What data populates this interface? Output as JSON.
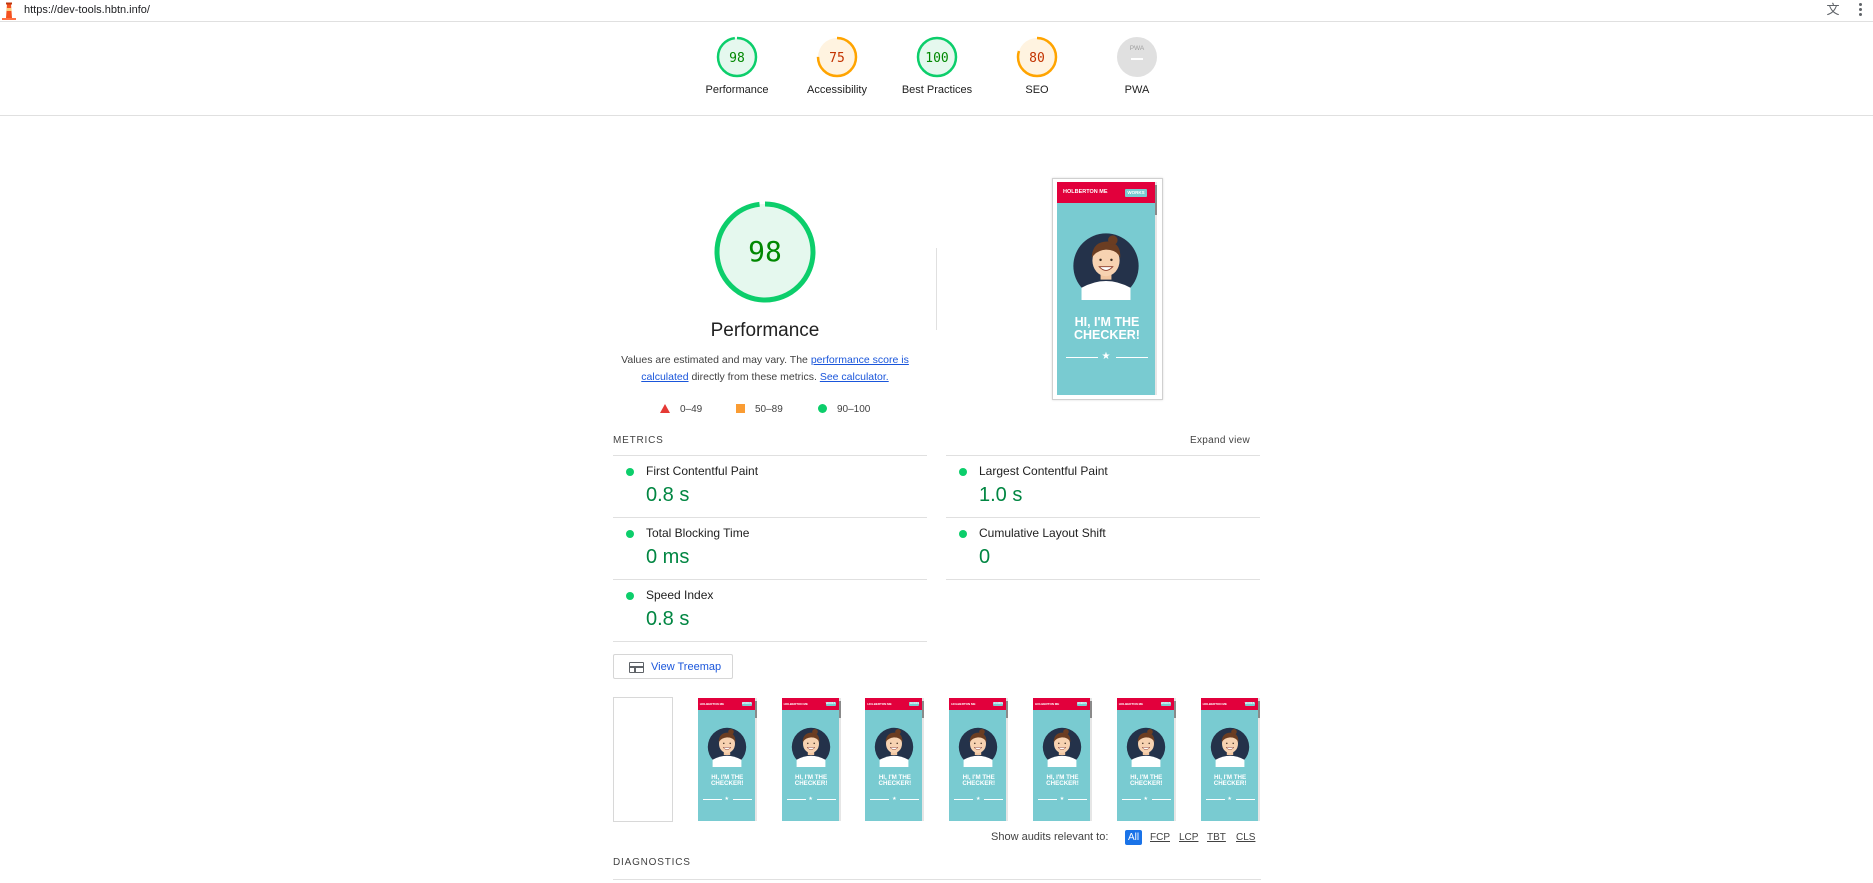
{
  "browser": {
    "url": "https://dev-tools.hbtn.info/"
  },
  "categories": [
    {
      "label": "Performance",
      "score": "98",
      "value": 0.98,
      "status": "pass"
    },
    {
      "label": "Accessibility",
      "score": "75",
      "value": 0.75,
      "status": "average"
    },
    {
      "label": "Best Practices",
      "score": "100",
      "value": 1.0,
      "status": "pass"
    },
    {
      "label": "SEO",
      "score": "80",
      "value": 0.8,
      "status": "average"
    },
    {
      "label": "PWA",
      "score": "",
      "value": 0,
      "status": "na",
      "badge": "PWA"
    }
  ],
  "colors": {
    "pass": "#0cce6b",
    "pass_text": "#008800",
    "pass_fill": "#e5f8ee",
    "average": "#ffa400",
    "average_text": "#c33300",
    "average_fill": "#fff3e0",
    "fail": "#e53935",
    "na": "#dadada",
    "metric_value": "#018642",
    "link": "#1a56db",
    "screenshot_header": "#e2003c",
    "screenshot_bg": "#79cbd1"
  },
  "performance": {
    "score": "98",
    "value": 0.98,
    "title": "Performance",
    "desc_prefix": "Values are estimated and may vary. The ",
    "desc_link1": "performance score is calculated",
    "desc_middle": " directly from these metrics. ",
    "desc_link2": "See calculator."
  },
  "legend": {
    "fail": "0–49",
    "average": "50–89",
    "pass": "90–100"
  },
  "screenshot": {
    "brand": "HOLBERTON ME",
    "button": "WORKS",
    "heading_line1": "HI, I'M THE",
    "heading_line2": "CHECKER!",
    "star": "★"
  },
  "metrics": {
    "title": "METRICS",
    "expand_label": "Expand view",
    "items": [
      {
        "name": "First Contentful Paint",
        "value": "0.8 s"
      },
      {
        "name": "Largest Contentful Paint",
        "value": "1.0 s"
      },
      {
        "name": "Total Blocking Time",
        "value": "0 ms"
      },
      {
        "name": "Cumulative Layout Shift",
        "value": "0"
      },
      {
        "name": "Speed Index",
        "value": "0.8 s"
      }
    ]
  },
  "treemap": {
    "label": "View Treemap"
  },
  "filmstrip": {
    "frame_count": 8,
    "blank_frames": 1
  },
  "filter": {
    "label": "Show audits relevant to:",
    "chips": [
      "All",
      "FCP",
      "LCP",
      "TBT",
      "CLS"
    ],
    "active": "All"
  },
  "diagnostics": {
    "title": "DIAGNOSTICS"
  }
}
